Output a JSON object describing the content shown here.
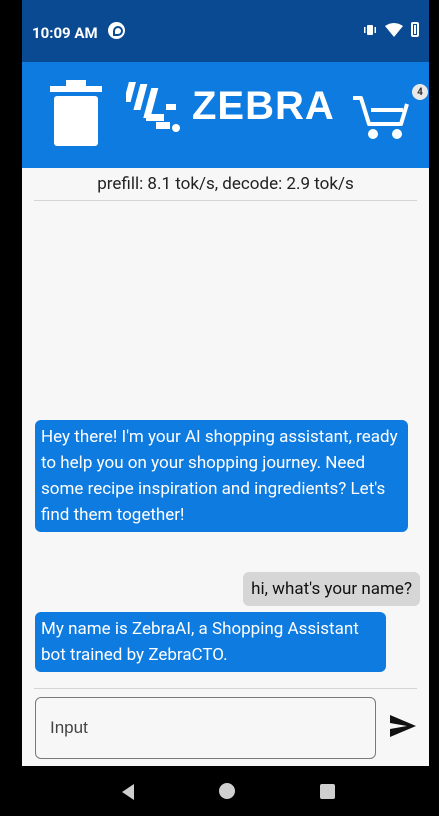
{
  "status_bar": {
    "time": "10:09 AM"
  },
  "app_bar": {
    "brand": "ZEBRA",
    "cart_count": "4",
    "colors": {
      "bar": "#0e7be1",
      "status": "#0a4a92"
    }
  },
  "stats": "prefill: 8.1 tok/s, decode: 2.9 tok/s",
  "messages": [
    {
      "role": "bot",
      "text": "Hey there! I'm your AI shopping assistant, ready to help you on your shopping journey. Need some recipe inspiration and ingredients? Let's find them together!"
    },
    {
      "role": "user",
      "text": "hi, what's your name?"
    },
    {
      "role": "bot",
      "text": "My name is ZebraAI, a Shopping Assistant bot trained by ZebraCTO."
    }
  ],
  "input": {
    "placeholder": "Input",
    "value": ""
  },
  "icons": {
    "delete": "trash-icon",
    "cart": "cart-icon",
    "send": "send-icon",
    "nav": [
      "back-icon",
      "home-icon",
      "recent-apps-icon"
    ]
  }
}
